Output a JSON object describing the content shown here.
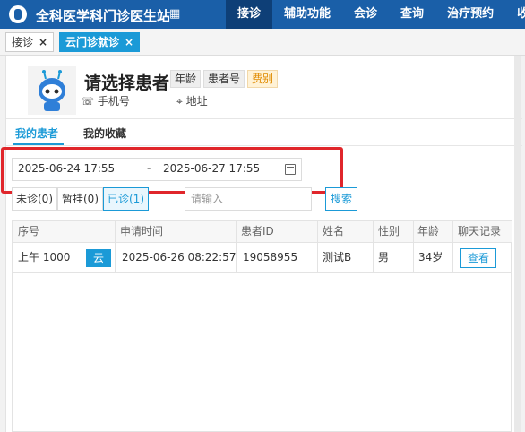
{
  "app": {
    "title": "全科医学科门诊医生站",
    "logo": "logo",
    "menu_icon": "grid-icon"
  },
  "menu": [
    {
      "label": "接诊",
      "active": true
    },
    {
      "label": "辅助功能",
      "active": false
    },
    {
      "label": "会诊",
      "active": false
    },
    {
      "label": "查询",
      "active": false
    },
    {
      "label": "治疗预约",
      "active": false
    },
    {
      "label": "收费",
      "active": false
    }
  ],
  "tabs": [
    {
      "label": "接诊",
      "close": "×"
    },
    {
      "label": "云门诊就诊",
      "close": "×"
    }
  ],
  "patient": {
    "name": "请选择患者",
    "badges": [
      "年龄",
      "患者号",
      "费别"
    ],
    "phone_label": "手机号",
    "address_label": "地址",
    "phone_icon": "phone-icon",
    "location_icon": "location-icon"
  },
  "subtabs": [
    "我的患者",
    "我的收藏"
  ],
  "date_range": {
    "start": "2025-06-24 17:55",
    "sep": "-",
    "end": "2025-06-27 17:55",
    "icon": "calendar-icon"
  },
  "filters": [
    "未诊(0)",
    "暂挂(0)",
    "已诊(1)"
  ],
  "search": {
    "placeholder": "请输入",
    "button": "搜索"
  },
  "table": {
    "headers": [
      "序号",
      "申请时间",
      "患者ID",
      "姓名",
      "性别",
      "年龄",
      "聊天记录"
    ],
    "rows": [
      {
        "seq": "上午 1000",
        "cloud": "云",
        "time": "2025-06-26 08:22:57",
        "pid": "19058955",
        "name": "测试B",
        "sex": "男",
        "age": "34岁",
        "action": "查看"
      }
    ]
  },
  "colors": {
    "topbar": "#1a5fa8",
    "accent": "#1b9ad7",
    "highlight": "#e0262b",
    "badge_fee": "#e08b00"
  }
}
